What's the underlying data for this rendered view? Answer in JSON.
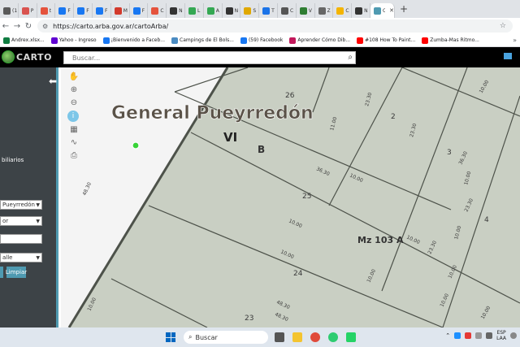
{
  "browser": {
    "tabs": [
      {
        "label": "(1",
        "color": "#5a5a5a"
      },
      {
        "label": "P",
        "color": "#d9534f"
      },
      {
        "label": "t",
        "color": "#e5533d"
      },
      {
        "label": "F",
        "color": "#1877f2"
      },
      {
        "label": "F",
        "color": "#1877f2"
      },
      {
        "label": "F",
        "color": "#1877f2"
      },
      {
        "label": "M",
        "color": "#d33a2c"
      },
      {
        "label": "F",
        "color": "#1877f2"
      },
      {
        "label": "C",
        "color": "#e5533d"
      },
      {
        "label": "N",
        "color": "#333333"
      },
      {
        "label": "L",
        "color": "#34a853"
      },
      {
        "label": "A",
        "color": "#34a853"
      },
      {
        "label": "N",
        "color": "#333333"
      },
      {
        "label": "S",
        "color": "#e0a800"
      },
      {
        "label": "T",
        "color": "#1a73e8"
      },
      {
        "label": "C",
        "color": "#555555"
      },
      {
        "label": "V",
        "color": "#2e7d32"
      },
      {
        "label": "Z",
        "color": "#666666"
      },
      {
        "label": "C",
        "color": "#f4b400"
      },
      {
        "label": "N",
        "color": "#333333"
      }
    ],
    "active_tab_label": "C",
    "new_tab": "+",
    "address": "https://carto.arba.gov.ar/cartoArba/",
    "bookmarks": [
      {
        "label": "Andrex.xlsx...",
        "color": "#107c41"
      },
      {
        "label": "Yahoo - Ingreso",
        "color": "#6001d2"
      },
      {
        "label": "¡Bienvenido a Faceb...",
        "color": "#1877f2"
      },
      {
        "label": "Campings de El Bols...",
        "color": "#4a8bc2"
      },
      {
        "label": "(59) Facebook",
        "color": "#1877f2"
      },
      {
        "label": "Aprender Cómo Dib...",
        "color": "#c2185b"
      },
      {
        "label": "#108 How To Paint...",
        "color": "#ff0000"
      },
      {
        "label": "Zumba-Mas Ritmo...",
        "color": "#ff0000"
      }
    ],
    "bookmarks_more": "»"
  },
  "app": {
    "logo": "CARTO",
    "search_placeholder": "Buscar..."
  },
  "sidebar": {
    "label": "biliarios",
    "select1": "Pueyrredón",
    "select2": "or",
    "input1": "",
    "select3": "alle",
    "buttons": [
      "",
      "Limpiar"
    ]
  },
  "map": {
    "district": "General Pueyrredón",
    "roman": "VI",
    "section": "B",
    "manzana": "Mz 103 A",
    "parcels": [
      "26",
      "2",
      "3",
      "25",
      "4",
      "24",
      "23"
    ],
    "dimensions": [
      "10.00",
      "11.00",
      "23.30",
      "36.30",
      "10.00",
      "23.30",
      "10.00",
      "10.00",
      "23.30",
      "36.30",
      "10.00",
      "10.00",
      "48.30",
      "10.00",
      "10.00",
      "48.30",
      "10.00",
      "10.00",
      "48.30",
      "10.00",
      "23.30",
      "10.00"
    ],
    "colors": {
      "parcel": "#c9cfc3",
      "outside": "#f4f4f4",
      "line": "#4d524a",
      "label": "#3a3a3a"
    }
  },
  "taskbar": {
    "search": "Buscar",
    "lang1": "ESP",
    "lang2": "LAA"
  }
}
